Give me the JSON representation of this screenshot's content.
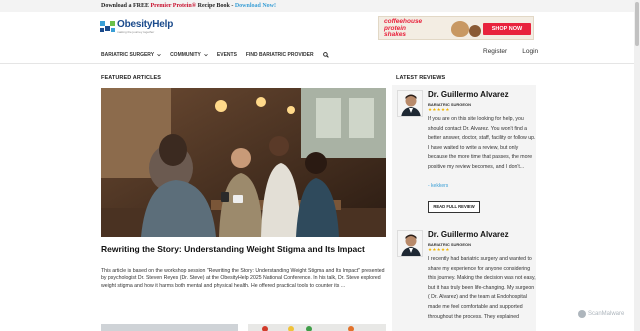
{
  "promo_bar": {
    "prefix": "Download a FREE",
    "highlight": "Premier Protein®",
    "middle": "Recipe Book -",
    "link": "Download Now!"
  },
  "header": {
    "logo_text": "ObesityHelp",
    "logo_tagline": "making the journey together",
    "ad": {
      "title_line1": "coffeehouse",
      "title_line2": "protein",
      "title_line3": "shakes",
      "cta": "SHOP NOW"
    },
    "nav": [
      {
        "label": "BARIATRIC SURGERY",
        "has_dropdown": true
      },
      {
        "label": "COMMUNITY",
        "has_dropdown": true
      },
      {
        "label": "EVENTS",
        "has_dropdown": false
      },
      {
        "label": "FIND BARIATRIC PROVIDER",
        "has_dropdown": false
      }
    ],
    "register": "Register",
    "login": "Login"
  },
  "featured": {
    "section_label": "FEATURED ARTICLES",
    "title": "Rewriting the Story: Understanding Weight Stigma and Its Impact",
    "excerpt": "This article is based on the workshop session \"Rewriting the Story: Understanding Weight Stigma and Its Impact\" presented by psychologist Dr. Steven Reyes (Dr. Steve) at the ObesityHelp 2025 National Conference. In his talk, Dr. Steve explored weight stigma and how it harms both mental and physical health. He offered practical tools to counter its ..."
  },
  "reviews": {
    "section_label": "LATEST REVIEWS",
    "items": [
      {
        "name": "Dr. Guillermo Alvarez",
        "role": "BARIATRIC SURGEON",
        "rating": 5,
        "text": "If you are on this site looking for help, you should contact Dr. Alvarez. You won't find a better answer, doctor, staff, facility or follow up. I have waited to write a review, but only because the more time that passes, the more positive my review becomes, and I don't...",
        "author": "- kekkers",
        "button": "READ FULL REVIEW"
      },
      {
        "name": "Dr. Guillermo Alvarez",
        "role": "BARIATRIC SURGEON",
        "rating": 5,
        "text": "I recently had bariatric surgery and wanted to share my experience for anyone considering this journey. Making the decision was not easy, but it has truly been life-changing. My surgeon ( Dr. Alvarez) and the team at Endohospital made me feel comfortable and supported throughout the process. They explained"
      }
    ]
  },
  "watermark": "ScanMalware",
  "colors": {
    "accent_red": "#c8102e",
    "link_blue": "#3a9fd6",
    "brand_navy": "#1b4b8c",
    "star_gold": "#f0b400"
  }
}
